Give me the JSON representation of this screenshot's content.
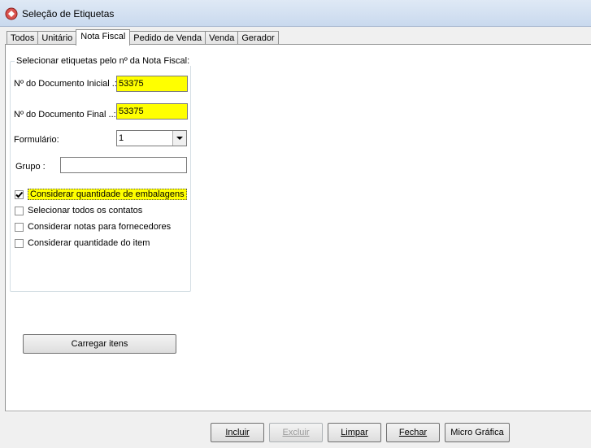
{
  "window": {
    "title": "Seleção de Etiquetas"
  },
  "tabs": [
    {
      "label": "Todos"
    },
    {
      "label": "Unitário"
    },
    {
      "label": "Nota Fiscal"
    },
    {
      "label": "Pedido de Venda"
    },
    {
      "label": "Venda"
    },
    {
      "label": "Gerador"
    }
  ],
  "group": {
    "title": "Selecionar etiquetas pelo nº da Nota Fiscal:",
    "doc_inicial": {
      "label": "Nº do Documento Inicial .:",
      "value": "53375"
    },
    "doc_final": {
      "label": "Nº do Documento Final ..:",
      "value": "53375"
    },
    "formulario": {
      "label": "Formulário:",
      "value": "1"
    },
    "grupo": {
      "label": "Grupo :",
      "value": ""
    },
    "checks": [
      {
        "label": "Considerar quantidade de embalagens",
        "checked": true
      },
      {
        "label": "Selecionar todos os contatos",
        "checked": false
      },
      {
        "label": "Considerar notas para fornecedores",
        "checked": false
      },
      {
        "label": "Considerar quantidade do item",
        "checked": false
      }
    ]
  },
  "load_button": "Carregar itens",
  "footer": {
    "incluir": "Incluir",
    "excluir": "Excluir",
    "limpar": "Limpar",
    "fechar": "Fechar",
    "micro": "Micro Gráfica"
  },
  "colors": {
    "highlight": "#ffff00",
    "tab_border": "#8e8f8f"
  }
}
